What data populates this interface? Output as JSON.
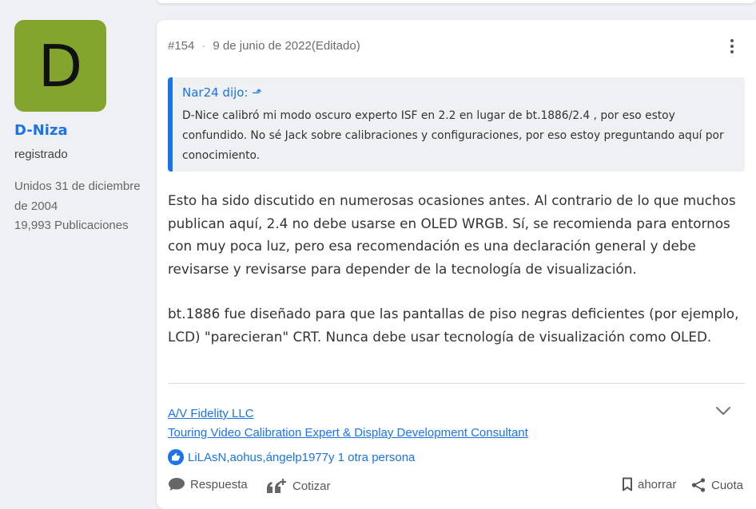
{
  "sidebar": {
    "avatar_letter": "D",
    "avatar_color": "#84a52d",
    "username": "D-Niza",
    "user_title": "registrado",
    "joined": "Unidos 31 de diciembre de 2004",
    "post_count": "19,993 Publicaciones"
  },
  "post": {
    "number": "#154",
    "separator": "·",
    "date": "9 de junio de 2022",
    "edited": "(Editado)",
    "more_icon": "more-vertical-icon",
    "quote": {
      "author_line": "Nar24 dijo: ⬏",
      "text": "D-Nice calibró mi modo oscuro experto ISF en 2.2 en lugar de bt.1886/2.4 , por eso estoy confundido. No sé Jack sobre calibraciones y configuraciones, por eso estoy preguntando aquí por conocimiento."
    },
    "paragraphs": [
      "Esto ha sido discutido en numerosas ocasiones antes. Al contrario de lo que muchos publican aquí, 2.4 no debe usarse en OLED WRGB. Sí, se recomienda para entornos con muy poca luz, pero esa recomendación es una declaración general y debe revisarse y revisarse para depender de la tecnología de visualización.",
      "bt.1886 fue diseñado para que las pantallas de piso negras deficientes (por ejemplo, LCD) \"parecieran\" CRT. Nunca debe usar tecnología de visualización como OLED."
    ],
    "signature": {
      "line1": "A/V Fidelity LLC",
      "line2": "Touring Video Calibration Expert & Display Development Consultant"
    },
    "reactions": {
      "icon": "thumbs-up-icon",
      "users": [
        "LiLAsN",
        "aohus",
        "ángelp1977"
      ],
      "comma1": ",",
      "comma2": ",",
      "others": "y 1 otra persona"
    },
    "actions": {
      "reply": "Respuesta",
      "quote": "Cotizar",
      "bookmark": "ahorrar",
      "share": "Cuota"
    }
  },
  "colors": {
    "accent": "#1a73e8",
    "background": "#eef0f4",
    "card": "#ffffff"
  }
}
